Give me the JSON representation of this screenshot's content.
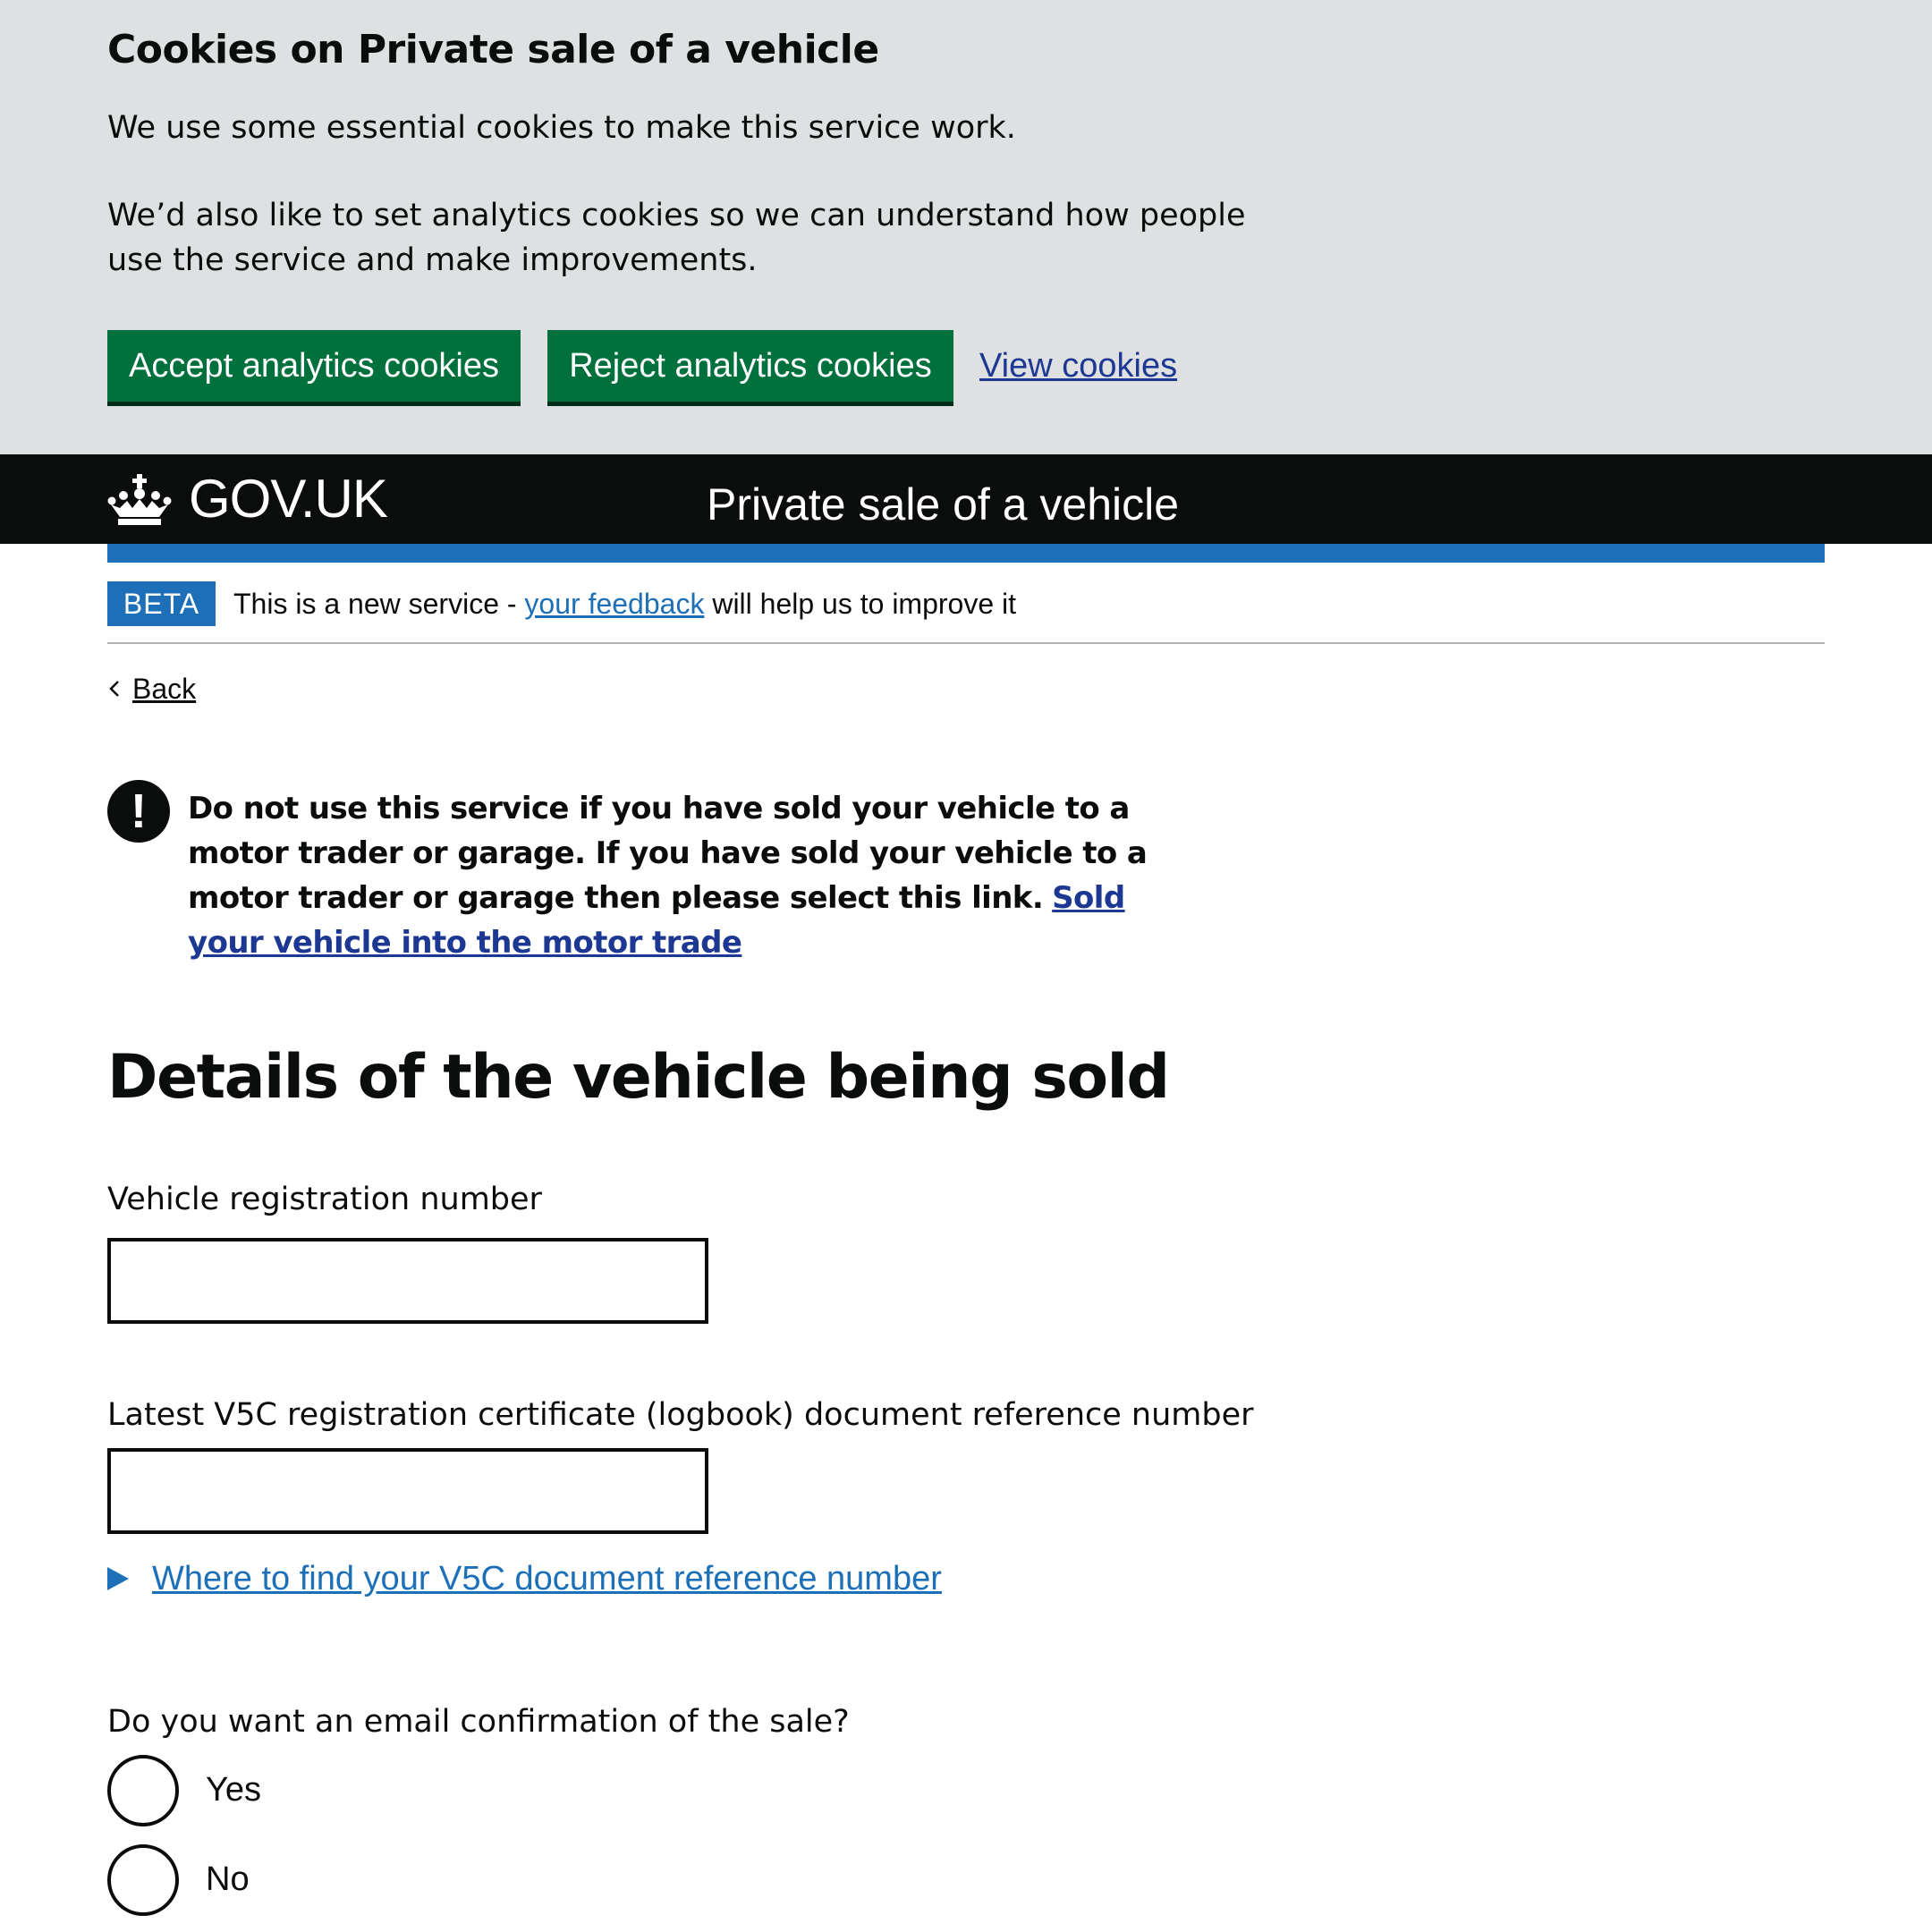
{
  "cookie_banner": {
    "title": "Cookies on Private sale of a vehicle",
    "paragraph_1": "We use some essential cookies to make this service work.",
    "paragraph_2": "We’d also like to set analytics cookies so we can understand how people use the service and make improvements.",
    "accept_label": "Accept analytics cookies",
    "reject_label": "Reject analytics cookies",
    "view_label": "View cookies"
  },
  "header": {
    "logo_text": "GOV.UK",
    "logo_icon": "crown-icon",
    "service_name": "Private sale of a vehicle"
  },
  "phase_banner": {
    "tag": "BETA",
    "text_before": "This is a new service - ",
    "link": "your feedback",
    "text_after": " will help us to improve it"
  },
  "back_link": {
    "label": "Back",
    "icon": "chevron-left-icon"
  },
  "warning": {
    "icon": "exclamation-icon",
    "icon_glyph": "!",
    "text": "Do not use this service if you have sold your vehicle to a motor trader or garage. If you have sold your vehicle to a motor trader or garage then please select this link.",
    "link": "Sold your vehicle into the motor trade"
  },
  "main": {
    "heading": "Details of the vehicle being sold",
    "vrn_label": "Vehicle registration number",
    "vrn_value": "",
    "v5c_label": "Latest V5C registration certificate (logbook) document reference number",
    "v5c_value": "",
    "details_summary": "Where to find your V5C document reference number",
    "details_icon": "triangle-right-icon",
    "email_question": "Do you want an email confirmation of the sale?",
    "radio_options": [
      "Yes",
      "No"
    ]
  },
  "colors": {
    "banner_bg": "#dee0e2",
    "button_green": "#00703c",
    "header_black": "#0b0c0c",
    "brand_blue": "#1d70b8",
    "link_dark_blue": "#1d3892"
  }
}
